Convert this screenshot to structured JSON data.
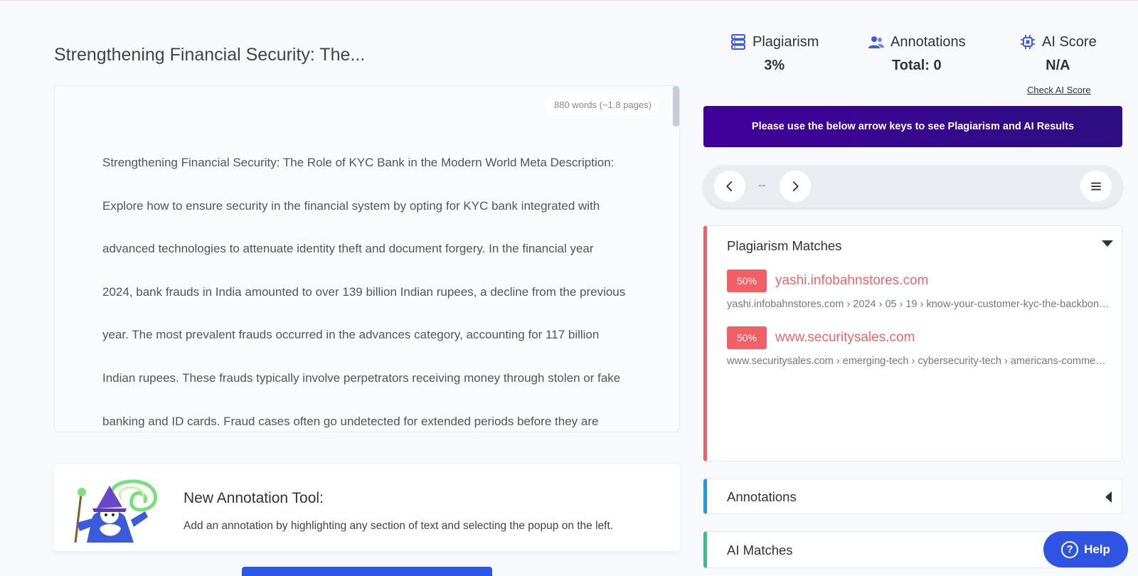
{
  "document": {
    "title": "Strengthening Financial Security: The...",
    "word_count": "880 words (~1.8 pages)",
    "lines": [
      "Strengthening Financial Security: The Role of KYC Bank in the Modern World Meta Description:",
      "Explore how to ensure security in the financial system by opting for KYC bank integrated with",
      "advanced technologies to attenuate identity theft and document forgery. In the financial year",
      "2024, bank frauds in India amounted to over 139 billion Indian rupees, a decline from the previous",
      "year. The most prevalent frauds occurred in the advances category, accounting for 117 billion",
      "Indian rupees. These frauds typically involve perpetrators receiving money through stolen or fake",
      "banking and ID cards. Fraud cases often go undetected for extended periods before they are"
    ]
  },
  "annotation_tool": {
    "title": "New Annotation Tool:",
    "description": "Add an annotation by highlighting any section of text and selecting the popup on the left."
  },
  "stats": {
    "plagiarism": {
      "label": "Plagiarism",
      "value": "3%",
      "icon": "database-icon"
    },
    "annotations": {
      "label": "Annotations",
      "value": "Total: 0",
      "icon": "users-icon"
    },
    "ai_score": {
      "label": "AI Score",
      "value": "N/A",
      "icon": "chip-icon",
      "link": "Check AI Score"
    }
  },
  "banner": {
    "text": "Please use the below arrow keys to see Plagiarism and AI Results"
  },
  "navigator": {
    "counter": "--"
  },
  "plagiarism_matches": {
    "title": "Plagiarism Matches",
    "items": [
      {
        "percent": "50%",
        "domain": "yashi.infobahnstores.com",
        "path": "yashi.infobahnstores.com › 2024 › 05 › 19 › know-your-customer-kyc-the-backbone-of-banking"
      },
      {
        "percent": "50%",
        "domain": "www.securitysales.com",
        "path": "www.securitysales.com › emerging-tech › cybersecurity-tech › americans-comment-on-security"
      }
    ]
  },
  "annotations_panel": {
    "title": "Annotations"
  },
  "ai_matches_panel": {
    "title": "AI Matches"
  },
  "help": {
    "label": "Help"
  },
  "colors": {
    "accent_blue": "#2f53e2",
    "banner_purple": "#41009b",
    "plagiarism_red": "#f25f66",
    "annotations_blue": "#2196f3",
    "ai_green": "#3dbf8a"
  }
}
